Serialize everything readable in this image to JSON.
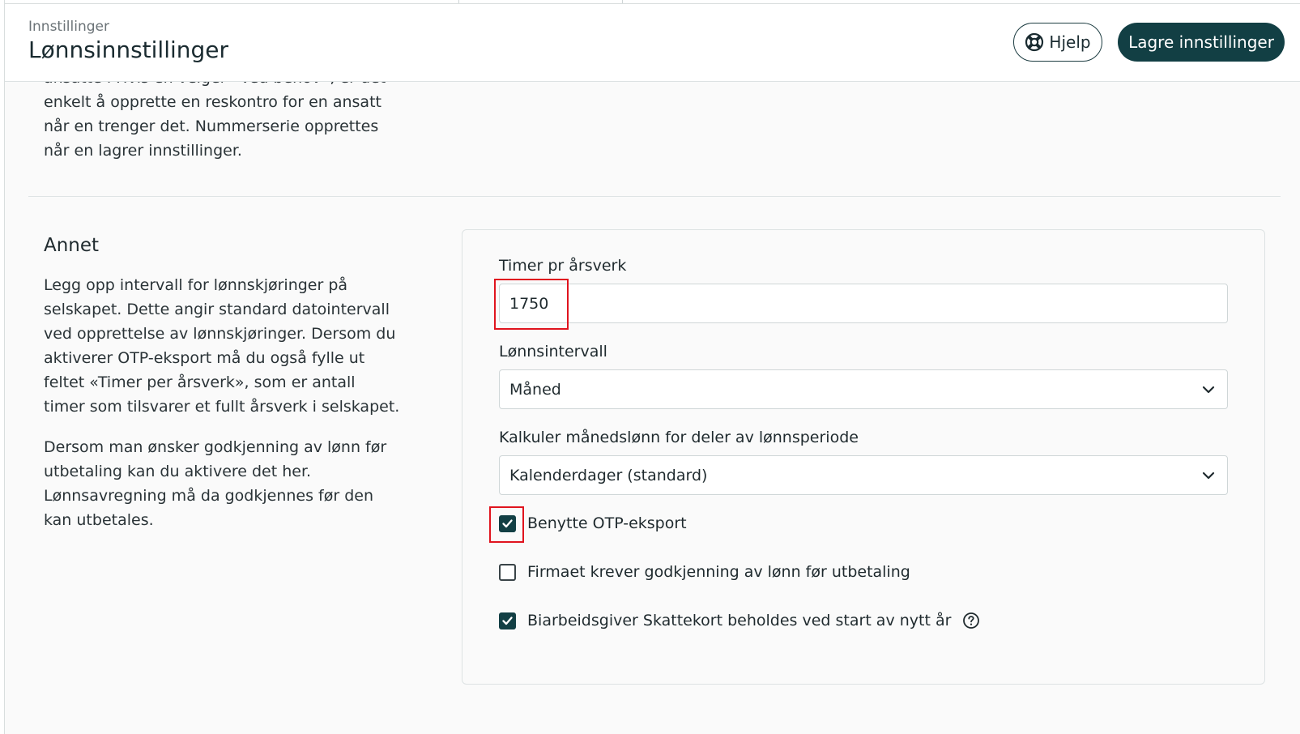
{
  "header": {
    "breadcrumb": "Innstillinger",
    "title": "Lønnsinnstillinger",
    "help_label": "Hjelp",
    "save_label": "Lagre innstillinger"
  },
  "intro_text": "ansatte i Hvis en velger «Ved behov», er det enkelt å opprette en reskontro for en ansatt når en trenger det. Nummerserie opprettes når en lagrer innstillinger.",
  "section": {
    "title": "Annet",
    "description_1": "Legg opp intervall for lønnskjøringer på selskapet. Dette angir standard datointervall ved opprettelse av lønnskjøringer. Dersom du aktiverer OTP-eksport må du også fylle ut feltet «Timer per årsverk», som er antall timer som tilsvarer et fullt årsverk i selskapet.",
    "description_2": "Dersom man ønsker godkjenning av lønn før utbetaling kan du aktivere det her. Lønnsavregning må da godkjennes før den kan utbetales."
  },
  "form": {
    "hours_label": "Timer pr årsverk",
    "hours_value": "1750",
    "interval_label": "Lønnsintervall",
    "interval_value": "Måned",
    "calc_label": "Kalkuler månedslønn for deler av lønnsperiode",
    "calc_value": "Kalenderdager (standard)",
    "checkboxes": [
      {
        "label": "Benytte OTP-eksport",
        "checked": true
      },
      {
        "label": "Firmaet krever godkjenning av lønn før utbetaling",
        "checked": false
      },
      {
        "label": "Biarbeidsgiver Skattekort beholdes ved start av nytt år",
        "checked": true
      }
    ]
  },
  "colors": {
    "primary": "#123f44",
    "highlight": "#e0141e"
  }
}
